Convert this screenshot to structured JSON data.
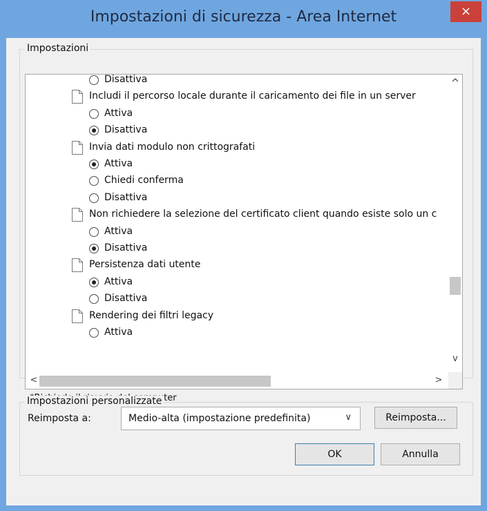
{
  "window": {
    "title": "Impostazioni di sicurezza - Area Internet",
    "close_glyph": "×"
  },
  "settings_group": {
    "label": "Impostazioni"
  },
  "list": [
    {
      "kind": "radio",
      "label": "Disattiva",
      "checked": false
    },
    {
      "kind": "setting",
      "label": "Includi il percorso locale durante il caricamento dei file in un server"
    },
    {
      "kind": "radio",
      "label": "Attiva",
      "checked": false
    },
    {
      "kind": "radio",
      "label": "Disattiva",
      "checked": true
    },
    {
      "kind": "setting",
      "label": "Invia dati modulo non crittografati"
    },
    {
      "kind": "radio",
      "label": "Attiva",
      "checked": true
    },
    {
      "kind": "radio",
      "label": "Chiedi conferma",
      "checked": false
    },
    {
      "kind": "radio",
      "label": "Disattiva",
      "checked": false
    },
    {
      "kind": "setting",
      "label": "Non richiedere la selezione del certificato client quando esiste solo un c"
    },
    {
      "kind": "radio",
      "label": "Attiva",
      "checked": false
    },
    {
      "kind": "radio",
      "label": "Disattiva",
      "checked": true
    },
    {
      "kind": "setting",
      "label": "Persistenza dati utente"
    },
    {
      "kind": "radio",
      "label": "Attiva",
      "checked": true
    },
    {
      "kind": "radio",
      "label": "Disattiva",
      "checked": false
    },
    {
      "kind": "setting",
      "label": "Rendering dei filtri legacy"
    },
    {
      "kind": "radio",
      "label": "Attiva",
      "checked": false
    }
  ],
  "scroll": {
    "up": "^",
    "down": "v",
    "left": "<",
    "right": ">"
  },
  "note": "*Richiede il riavvio del computer",
  "custom_group": {
    "label": "Impostazioni personalizzate"
  },
  "reset": {
    "label": "Reimposta a:",
    "selected": "Medio-alta (impostazione predefinita)",
    "chevron": "∨",
    "button": "Reimposta..."
  },
  "buttons": {
    "ok": "OK",
    "cancel": "Annulla"
  },
  "colors": {
    "titlebar": "#6fa6df",
    "close": "#c9413a",
    "client": "#f0f0f0"
  }
}
